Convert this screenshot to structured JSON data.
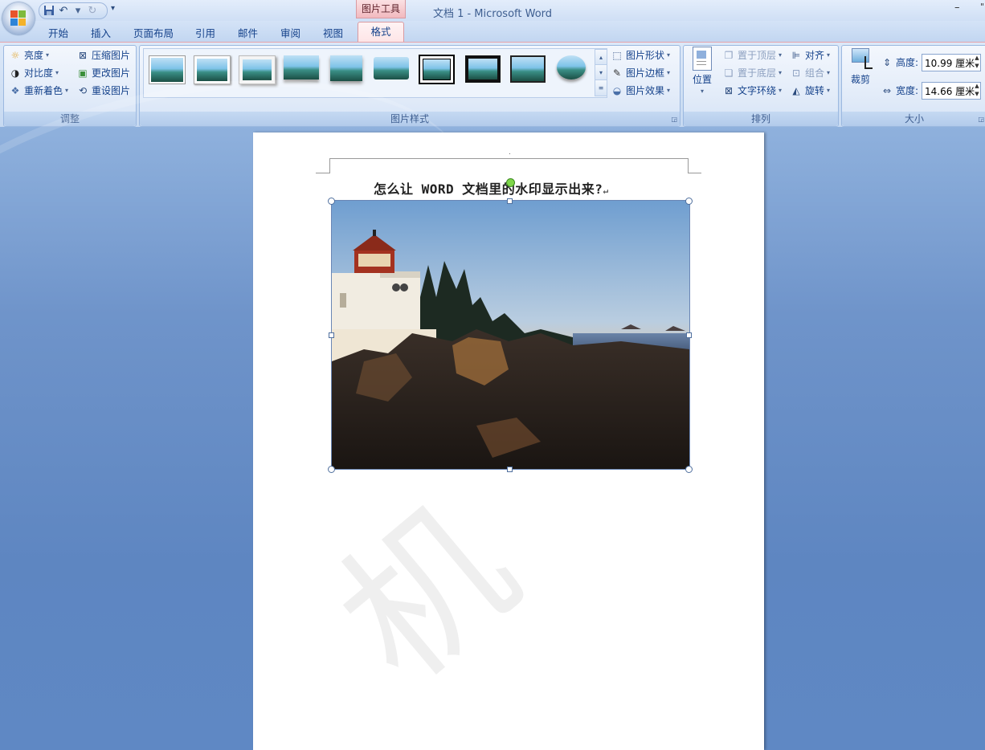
{
  "window": {
    "title": "文档 1 - Microsoft Word",
    "minimize": "–",
    "close_fragment": "\"",
    "tools_tab": "图片工具"
  },
  "qat": {
    "save_icon": "save-icon",
    "undo_icon": "undo-icon",
    "redo_icon": "redo-icon",
    "more": "▾"
  },
  "tabs": [
    "开始",
    "插入",
    "页面布局",
    "引用",
    "邮件",
    "审阅",
    "视图",
    "格式"
  ],
  "active_tab": "格式",
  "groups": {
    "adjust": {
      "label": "调整",
      "brightness": "亮度",
      "contrast": "对比度",
      "recolor": "重新着色",
      "compress": "压缩图片",
      "change": "更改图片",
      "reset": "重设图片"
    },
    "styles": {
      "label": "图片样式",
      "shape": "图片形状",
      "border": "图片边框",
      "effects": "图片效果"
    },
    "arrange": {
      "label": "排列",
      "position": "位置",
      "bring_front": "置于顶层",
      "send_back": "置于底层",
      "text_wrap": "文字环绕",
      "align": "对齐",
      "group": "组合",
      "rotate": "旋转"
    },
    "size": {
      "label": "大小",
      "crop": "裁剪",
      "height_label": "高度:",
      "height_value": "10.99 厘米",
      "width_label": "宽度:",
      "width_value": "14.66 厘米"
    }
  },
  "document": {
    "title": "怎么让 WORD 文档里的水印显示出来?",
    "paragraph_mark": "↵",
    "header_mark": ".",
    "watermark": "机"
  },
  "colors": {
    "accent_pink": "#f2b9bf",
    "ribbon_blue": "#c6d9f1",
    "text_blue": "#15428b"
  }
}
